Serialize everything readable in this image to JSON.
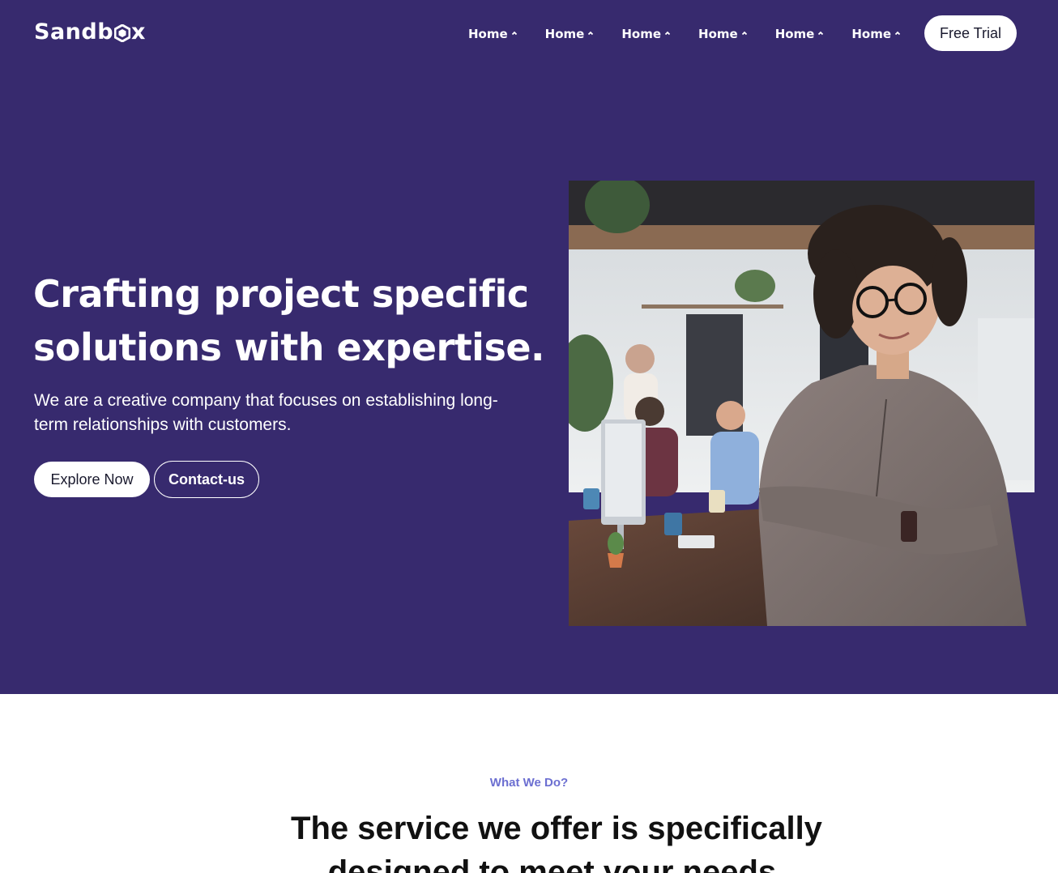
{
  "brand": {
    "logo_text_before": "Sandb",
    "logo_text_after": "x"
  },
  "nav": {
    "items": [
      {
        "label": "Home"
      },
      {
        "label": "Home"
      },
      {
        "label": "Home"
      },
      {
        "label": "Home"
      },
      {
        "label": "Home"
      },
      {
        "label": "Home"
      }
    ],
    "cta_label": "Free Trial"
  },
  "hero": {
    "title": "Crafting project specific solutions with expertise.",
    "subtitle": "We are a creative company that focuses on establishing long-term relationships with customers.",
    "primary_button": "Explore Now",
    "secondary_button": "Contact-us"
  },
  "services": {
    "eyebrow": "What We Do?",
    "title": "The service we offer is specifically designed to meet your needs."
  },
  "colors": {
    "hero_background": "#372a6e",
    "accent": "#6c6fd1",
    "text_on_dark": "#ffffff"
  }
}
